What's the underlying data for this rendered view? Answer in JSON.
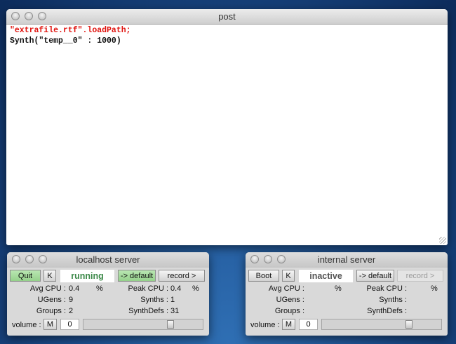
{
  "post": {
    "title": "post",
    "lines": [
      "\"extrafile.rtf\".loadPath;",
      "Synth(\"temp__0\" : 1000)"
    ]
  },
  "servers": [
    {
      "title": "localhost server",
      "boot_label": "Quit",
      "kill_label": "K",
      "status": "running",
      "default_label": "-> default",
      "record_label": "record >",
      "avg_cpu_label": "Avg CPU :",
      "avg_cpu": "0.4",
      "pct": "%",
      "peak_cpu_label": "Peak CPU :",
      "peak_cpu": "0.4",
      "ugens_label": "UGens :",
      "ugens": "9",
      "synths_label": "Synths :",
      "synths": "1",
      "groups_label": "Groups :",
      "groups": "2",
      "synthdefs_label": "SynthDefs :",
      "synthdefs": "31",
      "volume_label": "volume :",
      "mute_label": "M",
      "volume": "0",
      "volume_slider_fraction": 0.7
    },
    {
      "title": "internal server",
      "boot_label": "Boot",
      "kill_label": "K",
      "status": "inactive",
      "default_label": "-> default",
      "record_label": "record >",
      "avg_cpu_label": "Avg CPU :",
      "avg_cpu": "",
      "pct": "%",
      "peak_cpu_label": "Peak CPU :",
      "peak_cpu": "",
      "ugens_label": "UGens :",
      "ugens": "",
      "synths_label": "Synths :",
      "synths": "",
      "groups_label": "Groups :",
      "groups": "",
      "synthdefs_label": "SynthDefs :",
      "synthdefs": "",
      "volume_label": "volume :",
      "mute_label": "M",
      "volume": "0",
      "volume_slider_fraction": 0.7
    }
  ],
  "colors": {
    "running": "#3d8a4a",
    "inactive": "#555555",
    "boot_green": "#a6dc9c",
    "post_red": "#e0140f"
  }
}
